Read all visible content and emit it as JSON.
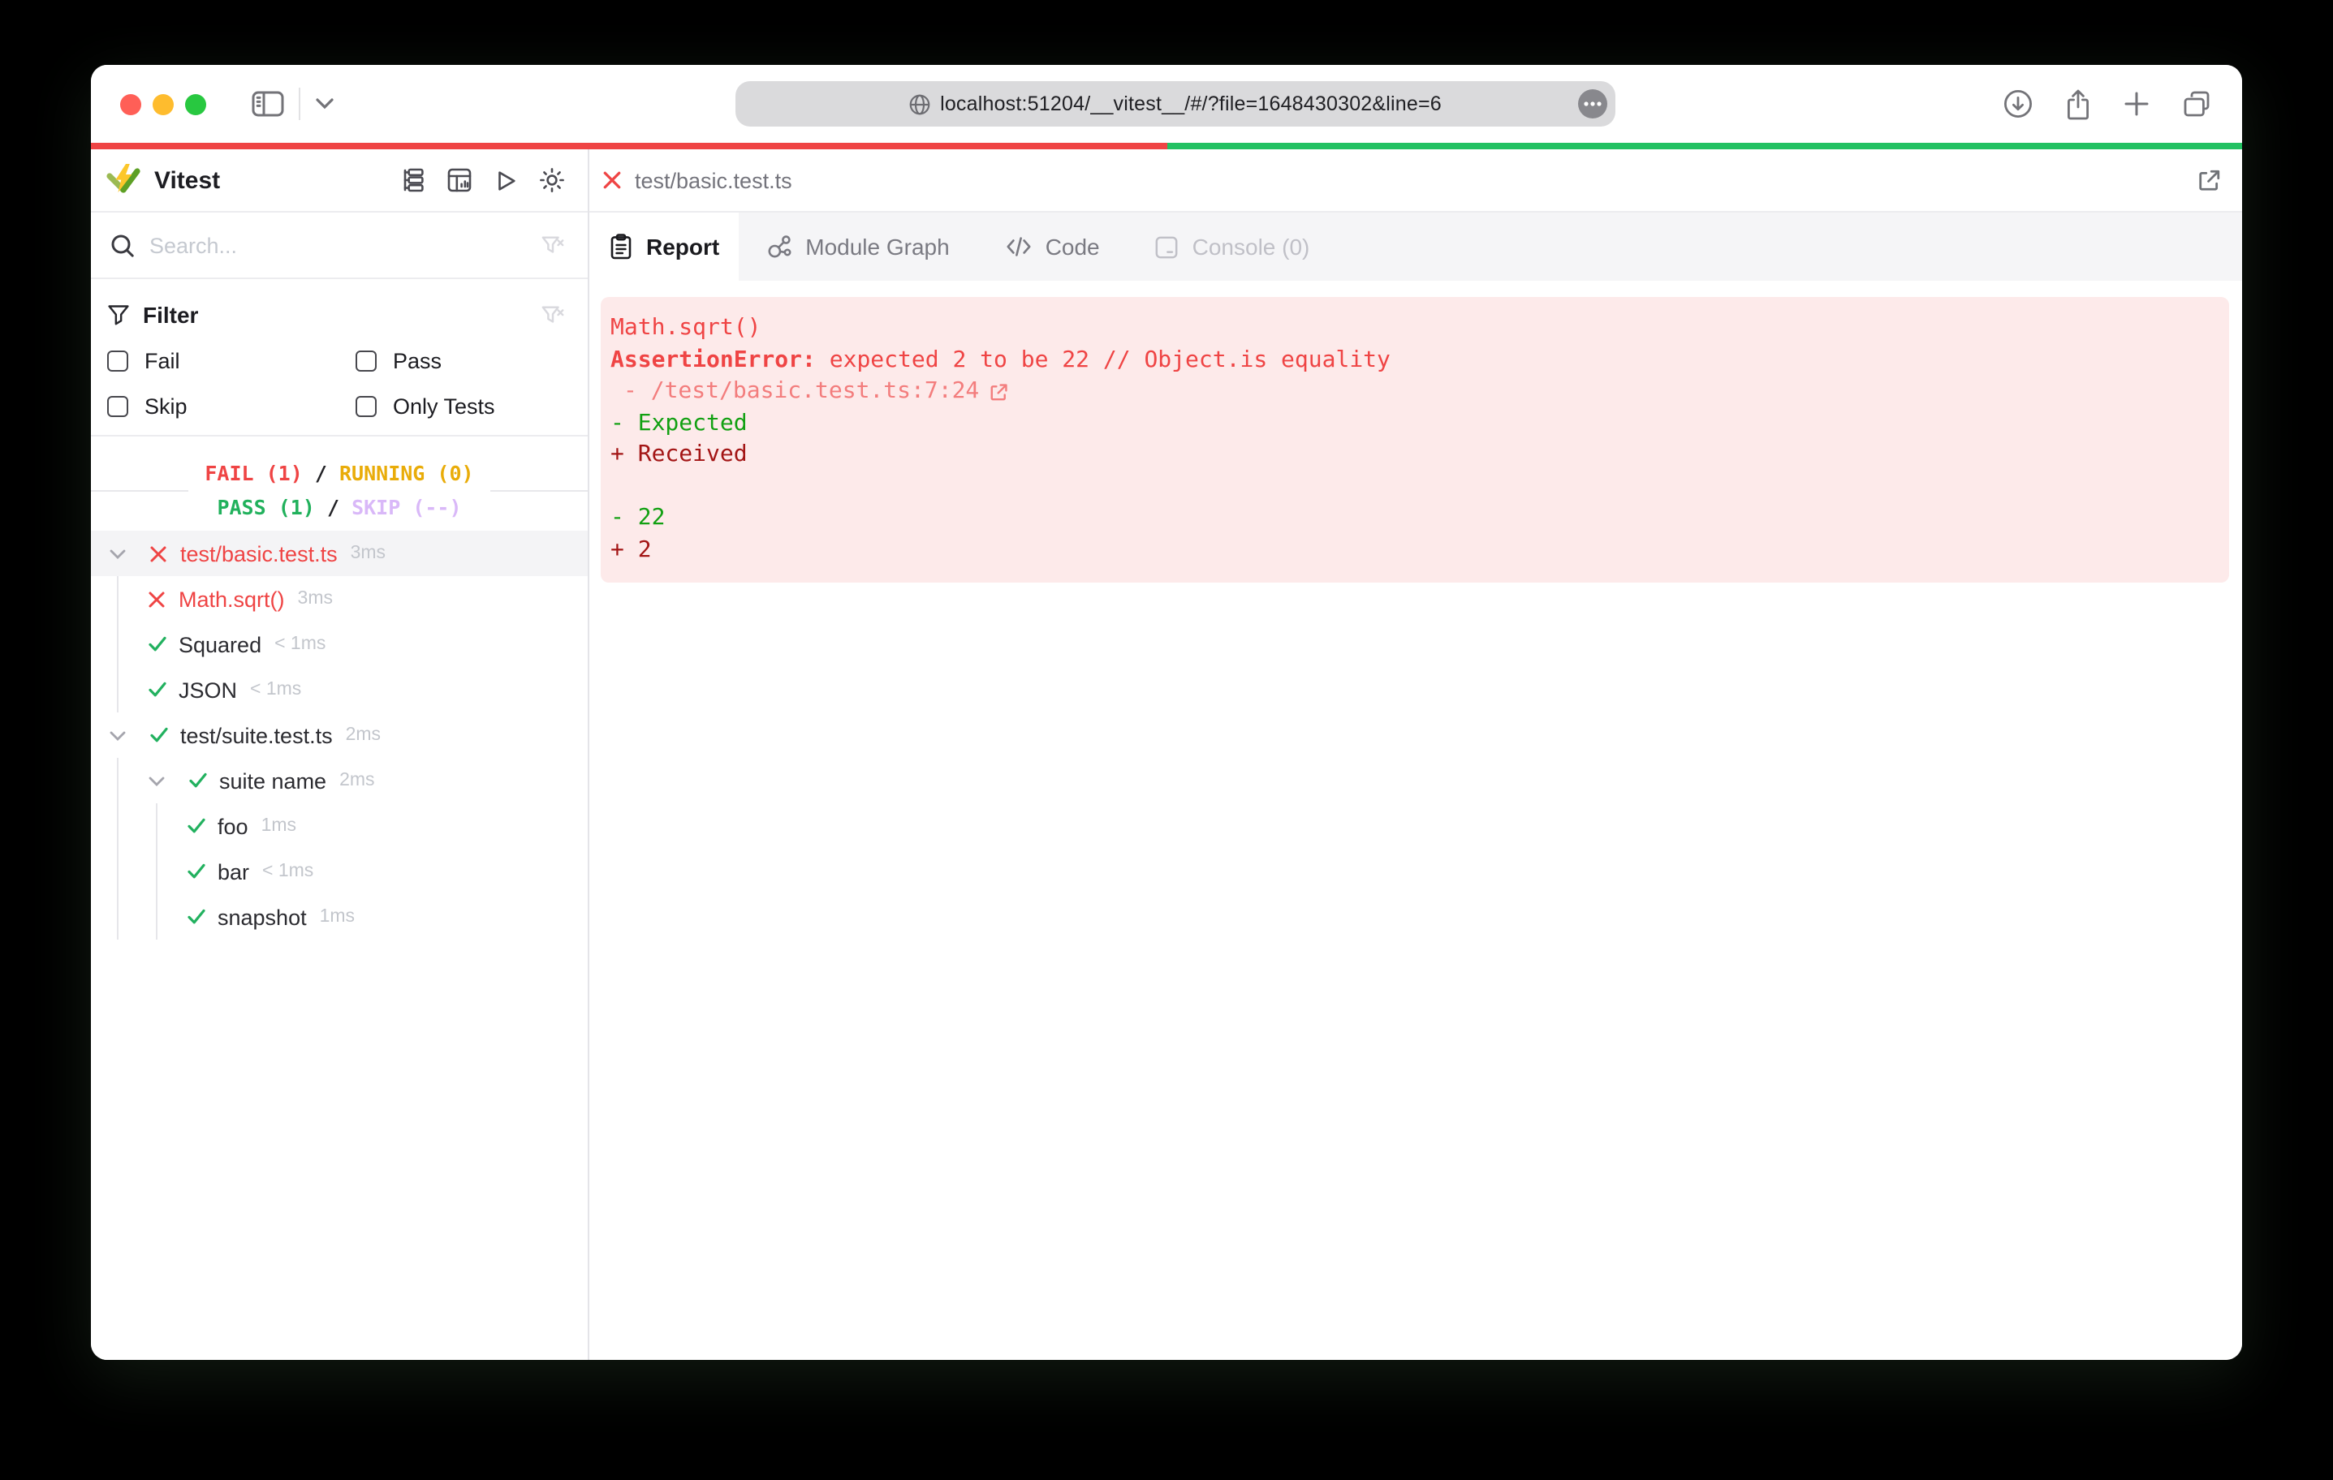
{
  "browser": {
    "url": "localhost:51204/__vitest__/#/?file=1648430302&line=6"
  },
  "progress": {
    "fail_color": "#ef4444",
    "pass_color": "#23c162",
    "fail_fraction": 0.5,
    "pass_fraction": 0.5
  },
  "sidebar": {
    "title": "Vitest",
    "search": {
      "placeholder": "Search..."
    },
    "filter": {
      "title": "Filter",
      "options": [
        {
          "label": "Fail",
          "checked": false
        },
        {
          "label": "Pass",
          "checked": false
        },
        {
          "label": "Skip",
          "checked": false
        },
        {
          "label": "Only Tests",
          "checked": false
        }
      ]
    },
    "stats": {
      "fail": "FAIL (1)",
      "sep1": "/",
      "running": "RUNNING (0)",
      "pass": "PASS (1)",
      "sep2": "/",
      "skip": "SKIP (--)",
      "colors": {
        "fail": "#ef4444",
        "running": "#e9ac09",
        "pass": "#21b15c",
        "skip": "#d9b8f8"
      }
    },
    "tree": [
      {
        "label": "test/basic.test.ts",
        "duration": "3ms",
        "status": "fail",
        "level": 0,
        "expanded": true,
        "selected": true
      },
      {
        "label": "Math.sqrt()",
        "duration": "3ms",
        "status": "fail",
        "level": 1
      },
      {
        "label": "Squared",
        "duration": "< 1ms",
        "status": "pass",
        "level": 1
      },
      {
        "label": "JSON",
        "duration": "< 1ms",
        "status": "pass",
        "level": 1
      },
      {
        "label": "test/suite.test.ts",
        "duration": "2ms",
        "status": "pass",
        "level": 0,
        "expanded": true
      },
      {
        "label": "suite name",
        "duration": "2ms",
        "status": "pass",
        "level": 1,
        "expanded": true
      },
      {
        "label": "foo",
        "duration": "1ms",
        "status": "pass",
        "level": 2
      },
      {
        "label": "bar",
        "duration": "< 1ms",
        "status": "pass",
        "level": 2
      },
      {
        "label": "snapshot",
        "duration": "1ms",
        "status": "pass",
        "level": 2
      }
    ]
  },
  "main": {
    "file_tab": {
      "label": "test/basic.test.ts"
    },
    "tabs": [
      {
        "label": "Report",
        "active": true
      },
      {
        "label": "Module Graph",
        "active": false
      },
      {
        "label": "Code",
        "active": false
      },
      {
        "label": "Console (0)",
        "active": false,
        "disabled": true
      }
    ],
    "report": {
      "test_title": "Math.sqrt()",
      "error_name": "AssertionError:",
      "error_message": " expected 2 to be 22 // Object.is equality",
      "stack_link": "- /test/basic.test.ts:7:24",
      "diff": {
        "expected_label": "- Expected",
        "received_label": "+ Received",
        "expected_value": "- 22",
        "received_value": "+ 2"
      },
      "colors": {
        "error": "#ef4444",
        "stack": "#f37d7d",
        "expected": "#12a012",
        "received": "#a31515",
        "background": "#fdeaea"
      }
    }
  }
}
